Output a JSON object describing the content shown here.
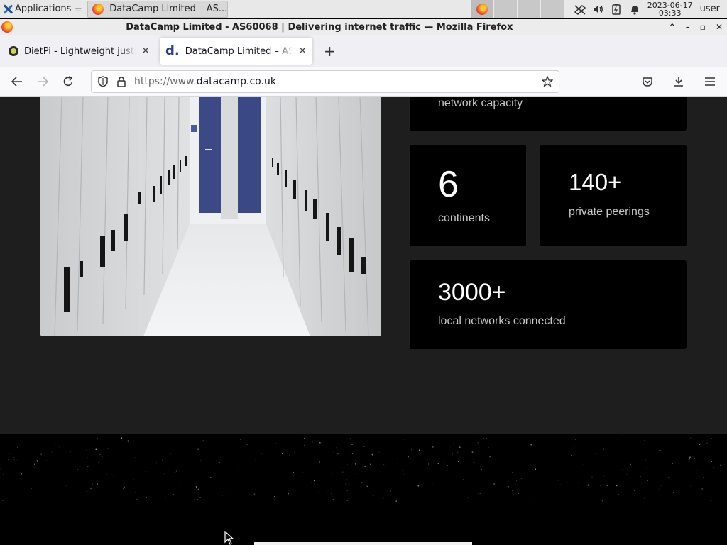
{
  "taskbar": {
    "apps_label": "Applications",
    "apps_glyph": "☰",
    "window_button_label": "DataCamp Limited – AS...",
    "clock_date": "2023-06-17",
    "clock_time": "03:33",
    "user_label": "user"
  },
  "window": {
    "title": "DataCamp Limited - AS60068 | Delivering internet traffic — Mozilla Firefox"
  },
  "tabs": [
    {
      "label": "DietPi - Lightweight justifiably",
      "icon": "dietpi-favicon",
      "active": false
    },
    {
      "label": "DataCamp Limited – AS60068",
      "icon": "datacamp-favicon",
      "active": true
    }
  ],
  "address": {
    "scheme": "https://www.",
    "host": "datacamp.co.uk"
  },
  "stats": {
    "capacity": {
      "label": "network capacity"
    },
    "continents": {
      "value": "6",
      "label": "continents"
    },
    "peerings": {
      "value": "140+",
      "label": "private peerings"
    },
    "local": {
      "value": "3000+",
      "label": "local networks connected"
    }
  },
  "icons": {
    "back": "arrow-left-icon",
    "forward": "arrow-right-icon",
    "reload": "reload-icon",
    "shield": "tracking-shield-icon",
    "lock": "lock-icon",
    "bookmark": "star-icon",
    "pocket": "pocket-icon",
    "downloads": "download-icon",
    "menu": "hamburger-menu-icon"
  },
  "colors": {
    "page_bg": "#1e1e1e",
    "card_bg": "#000000",
    "card_text": "#ffffff",
    "card_label": "#c8c8c8",
    "accent_datacamp": "#2e3a8c"
  }
}
